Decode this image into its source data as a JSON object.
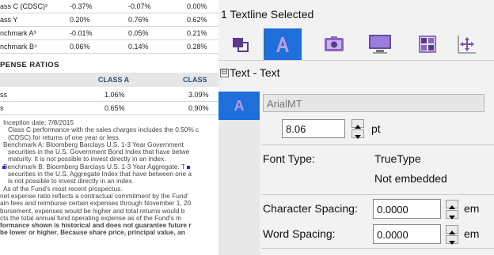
{
  "document": {
    "perf_rows": [
      {
        "label": "ass C (CDSC)²",
        "v1": "-0.37%",
        "v2": "-0.07%",
        "v3": "0.00%"
      },
      {
        "label": "ass Y",
        "v1": "0.20%",
        "v2": "0.76%",
        "v3": "0.62%"
      },
      {
        "label": "nchmark A³",
        "v1": "-0.01%",
        "v2": "0.05%",
        "v3": "0.21%"
      },
      {
        "label": "nchmark B⁴",
        "v1": "0.06%",
        "v2": "0.14%",
        "v3": "0.28%"
      }
    ],
    "expense_title": "PENSE RATIOS",
    "expense_headers": [
      "CLASS A",
      "CLASS"
    ],
    "expense_rows": [
      {
        "label": "ss",
        "a": "1.06%",
        "b": "3.09%"
      },
      {
        "label": "s",
        "a": "0.65%",
        "b": "0.90%"
      }
    ],
    "notes": [
      "Inception date: 7/8/2015",
      "Class C performance with the sales charges includes the 0.50% c",
      "(CDSC) for returns of one year or less.",
      "Benchmark A: Bloomberg Barclays U.S. 1-3 Year Government",
      "securities in the U.S. Government Bond Index that have betwe",
      "maturity. It is not possible to invest directly in an index.",
      "Benchmark B: Bloomberg Barclays U.S. 1-3 Year Aggregate. T",
      "securities in the U.S. Aggregate Index that have between one a",
      "is not possible to invest directly in an index.",
      "As of the Fund's most recent prospectus.",
      "net expense ratio reflects a contractual commitment by the Fund'",
      "ain fees and reimburse certain expenses through November 1, 20",
      "bursement, expenses would be higher and total returns would b",
      "cts the total annual fund operating expense as of the Fund's m",
      "formance shown is historical and does not guarantee future r",
      "be lower or higher. Because share price, principal value, an"
    ]
  },
  "panel": {
    "title": "1 Textline Selected",
    "section_title": "Text - Text",
    "collapse_symbol": "⊟",
    "font_badge_letter": "A",
    "tab_icons": [
      "layers-icon",
      "text-icon",
      "camera-icon",
      "monitor-icon",
      "grid-icon",
      "move-icon"
    ],
    "font_name": "ArialMT",
    "font_size": "8.06",
    "font_size_unit": "pt",
    "font_type_label": "Font Type:",
    "font_type_value": "TrueType",
    "embedded_value": "Not embedded",
    "char_spacing_label": "Character Spacing:",
    "char_spacing_value": "0.0000",
    "char_spacing_unit": "em",
    "word_spacing_label": "Word Spacing:",
    "word_spacing_value": "0.0000",
    "word_spacing_unit": "em",
    "colors": {
      "accent": "#1e6fd9",
      "text_icon": "#7a4fb8"
    }
  }
}
